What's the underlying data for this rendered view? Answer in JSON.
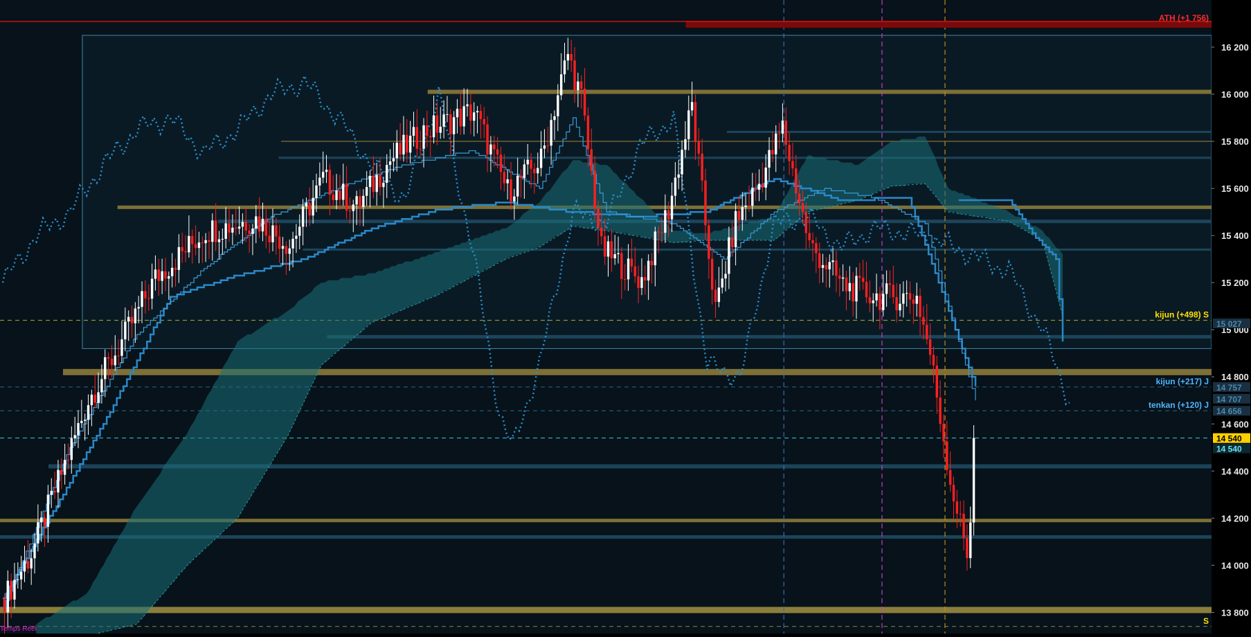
{
  "chart_data": {
    "type": "candlestick",
    "title": "",
    "status_label": "Temps Réel",
    "y_axis": {
      "ylim": [
        13710,
        16400
      ],
      "ticks": [
        16200,
        16000,
        15800,
        15600,
        15400,
        15200,
        15000,
        14800,
        14600,
        14400,
        14200,
        14000,
        13800
      ],
      "tick_labels": [
        "16 200",
        "16 000",
        "15 800",
        "15 600",
        "15 400",
        "15 200",
        "15 000",
        "14 800",
        "14 600",
        "14 400",
        "14 200",
        "14 000",
        "13 800"
      ]
    },
    "price_badges": [
      {
        "label": "15 027",
        "value": 15027,
        "style": "dark"
      },
      {
        "label": "14 757",
        "value": 14757,
        "style": "dark"
      },
      {
        "label": "14 707",
        "value": 14707,
        "style": "dark"
      },
      {
        "label": "14 656",
        "value": 14656,
        "style": "dark"
      },
      {
        "label": "14 540",
        "value": 14540,
        "style": "last"
      },
      {
        "label": "14 540",
        "value": 14540,
        "style": "cyan"
      }
    ],
    "annotations": [
      {
        "text": "ATH (+1 756)",
        "value": 16300,
        "color": "#ff2a2a"
      },
      {
        "text": "kijun (+498) S",
        "value": 15040,
        "color": "#ffe000"
      },
      {
        "text": "kijun (+217) J",
        "value": 14757,
        "color": "#4fb6ff"
      },
      {
        "text": "tenkan (+120) J",
        "value": 14656,
        "color": "#4fb6ff"
      },
      {
        "text": "S",
        "value": 13740,
        "color": "#ffe000"
      }
    ],
    "ath_level": 16300,
    "horizontal_levels": [
      {
        "value": 16010,
        "color": "#8a7a3a",
        "width": 6,
        "from": 0.353
      },
      {
        "value": 15800,
        "color": "#7a6a30",
        "width": 1.5,
        "from": 0.232
      },
      {
        "value": 15520,
        "color": "#8a7a3a",
        "width": 5,
        "from": 0.097
      },
      {
        "value": 14820,
        "color": "#8a7a3a",
        "width": 9,
        "from": 0.052
      },
      {
        "value": 14190,
        "color": "#8a7a3a",
        "width": 5,
        "from": 0.0
      },
      {
        "value": 13810,
        "color": "#9a8a40",
        "width": 9,
        "from": 0.0
      },
      {
        "value": 15840,
        "color": "#1e4a60",
        "width": 3,
        "from": 0.6
      },
      {
        "value": 15730,
        "color": "#1e4a60",
        "width": 3,
        "from": 0.23
      },
      {
        "value": 15460,
        "color": "#1e4a60",
        "width": 5,
        "from": 0.18
      },
      {
        "value": 15340,
        "color": "#1e4a60",
        "width": 3,
        "from": 0.25
      },
      {
        "value": 14970,
        "color": "#1e4a60",
        "width": 5,
        "from": 0.27
      },
      {
        "value": 14420,
        "color": "#1e4a60",
        "width": 6,
        "from": 0.04
      },
      {
        "value": 14120,
        "color": "#1e4a60",
        "width": 5,
        "from": 0.0
      },
      {
        "value": 13700,
        "color": "#1e4a60",
        "width": 4,
        "from": 0.0
      }
    ],
    "dashed_levels": [
      {
        "value": 15040,
        "color": "#b0b030"
      },
      {
        "value": 14757,
        "color": "#2a6a8a"
      },
      {
        "value": 14656,
        "color": "#2a6a8a"
      },
      {
        "value": 14540,
        "color": "#37d0e0"
      },
      {
        "value": 13740,
        "color": "#8a8a40"
      }
    ],
    "vertical_markers": [
      {
        "position": 0.647,
        "color": "#3a6ab0"
      },
      {
        "position": 0.728,
        "color": "#c040c0"
      },
      {
        "position": 0.78,
        "color": "#c08a20"
      }
    ],
    "rectangle_zone": {
      "x_from": 0.068,
      "x_to": 1.0,
      "y_from": 16250,
      "y_to": 14920
    },
    "candles": {
      "count": 290,
      "anchors": [
        [
          0,
          13860
        ],
        [
          8,
          14050
        ],
        [
          18,
          14430
        ],
        [
          25,
          14700
        ],
        [
          35,
          14950
        ],
        [
          45,
          15220
        ],
        [
          60,
          15420
        ],
        [
          75,
          15470
        ],
        [
          85,
          15360
        ],
        [
          95,
          15640
        ],
        [
          105,
          15520
        ],
        [
          115,
          15720
        ],
        [
          125,
          15840
        ],
        [
          140,
          15930
        ],
        [
          150,
          15590
        ],
        [
          160,
          15720
        ],
        [
          168,
          16170
        ],
        [
          172,
          15980
        ],
        [
          178,
          15340
        ],
        [
          190,
          15210
        ],
        [
          198,
          15510
        ],
        [
          205,
          15950
        ],
        [
          212,
          15080
        ],
        [
          218,
          15460
        ],
        [
          225,
          15620
        ],
        [
          232,
          15860
        ],
        [
          240,
          15360
        ],
        [
          250,
          15190
        ],
        [
          260,
          15140
        ],
        [
          272,
          15140
        ],
        [
          276,
          14900
        ],
        [
          282,
          14360
        ],
        [
          287,
          14050
        ],
        [
          290,
          14540
        ]
      ],
      "up_color": "#ffffff",
      "down_color": "#ff2020"
    },
    "ichimoku": {
      "tenkan": [
        [
          0,
          13820
        ],
        [
          20,
          14500
        ],
        [
          40,
          14980
        ],
        [
          60,
          15260
        ],
        [
          80,
          15480
        ],
        [
          100,
          15600
        ],
        [
          120,
          15700
        ],
        [
          140,
          15760
        ],
        [
          160,
          15600
        ],
        [
          170,
          15900
        ],
        [
          180,
          15500
        ],
        [
          200,
          15450
        ],
        [
          215,
          15300
        ],
        [
          230,
          15500
        ],
        [
          245,
          15600
        ],
        [
          260,
          15560
        ],
        [
          275,
          15450
        ],
        [
          290,
          14700
        ]
      ],
      "kijun": [
        [
          0,
          13860
        ],
        [
          30,
          14600
        ],
        [
          50,
          15140
        ],
        [
          70,
          15230
        ],
        [
          90,
          15300
        ],
        [
          110,
          15430
        ],
        [
          130,
          15510
        ],
        [
          150,
          15540
        ],
        [
          170,
          15500
        ],
        [
          190,
          15480
        ],
        [
          210,
          15500
        ],
        [
          230,
          15640
        ],
        [
          250,
          15550
        ],
        [
          270,
          15560
        ],
        [
          290,
          14760
        ]
      ],
      "chikou": [
        [
          0,
          15200
        ],
        [
          10,
          15400
        ],
        [
          20,
          15500
        ],
        [
          30,
          15700
        ],
        [
          40,
          15850
        ],
        [
          50,
          15900
        ],
        [
          60,
          15750
        ],
        [
          70,
          15850
        ],
        [
          80,
          16000
        ],
        [
          90,
          16050
        ],
        [
          100,
          15900
        ],
        [
          110,
          15700
        ],
        [
          120,
          15550
        ],
        [
          130,
          16000
        ],
        [
          140,
          15350
        ],
        [
          148,
          14650
        ],
        [
          152,
          14500
        ],
        [
          160,
          14850
        ],
        [
          170,
          15500
        ],
        [
          180,
          15450
        ],
        [
          190,
          15780
        ],
        [
          200,
          15900
        ],
        [
          210,
          14850
        ],
        [
          220,
          14800
        ],
        [
          230,
          15450
        ],
        [
          240,
          15480
        ],
        [
          250,
          15350
        ],
        [
          260,
          15430
        ],
        [
          275,
          15400
        ],
        [
          300,
          15250
        ],
        [
          310,
          15000
        ],
        [
          318,
          14700
        ]
      ],
      "kijun_future": [
        [
          285,
          15550
        ],
        [
          300,
          15550
        ],
        [
          308,
          15390
        ],
        [
          314,
          15300
        ],
        [
          316,
          14950
        ]
      ],
      "cloud": {
        "top": [
          [
            10,
            13750
          ],
          [
            25,
            13880
          ],
          [
            40,
            14250
          ],
          [
            55,
            14560
          ],
          [
            70,
            14950
          ],
          [
            85,
            15080
          ],
          [
            95,
            15200
          ],
          [
            110,
            15240
          ],
          [
            130,
            15330
          ],
          [
            150,
            15430
          ],
          [
            160,
            15540
          ],
          [
            170,
            15720
          ],
          [
            180,
            15700
          ],
          [
            200,
            15420
          ],
          [
            210,
            15410
          ],
          [
            230,
            15480
          ],
          [
            240,
            15740
          ],
          [
            255,
            15700
          ],
          [
            265,
            15800
          ],
          [
            275,
            15820
          ],
          [
            282,
            15600
          ],
          [
            300,
            15500
          ],
          [
            310,
            15420
          ],
          [
            316,
            15320
          ]
        ],
        "bottom": [
          [
            10,
            13700
          ],
          [
            25,
            13700
          ],
          [
            40,
            13750
          ],
          [
            55,
            14000
          ],
          [
            70,
            14200
          ],
          [
            85,
            14550
          ],
          [
            95,
            14850
          ],
          [
            110,
            15030
          ],
          [
            130,
            15150
          ],
          [
            150,
            15300
          ],
          [
            160,
            15350
          ],
          [
            170,
            15440
          ],
          [
            180,
            15420
          ],
          [
            200,
            15370
          ],
          [
            210,
            15380
          ],
          [
            230,
            15380
          ],
          [
            240,
            15500
          ],
          [
            255,
            15550
          ],
          [
            265,
            15610
          ],
          [
            275,
            15620
          ],
          [
            282,
            15500
          ],
          [
            300,
            15460
          ],
          [
            310,
            15380
          ],
          [
            316,
            15060
          ]
        ]
      }
    }
  }
}
